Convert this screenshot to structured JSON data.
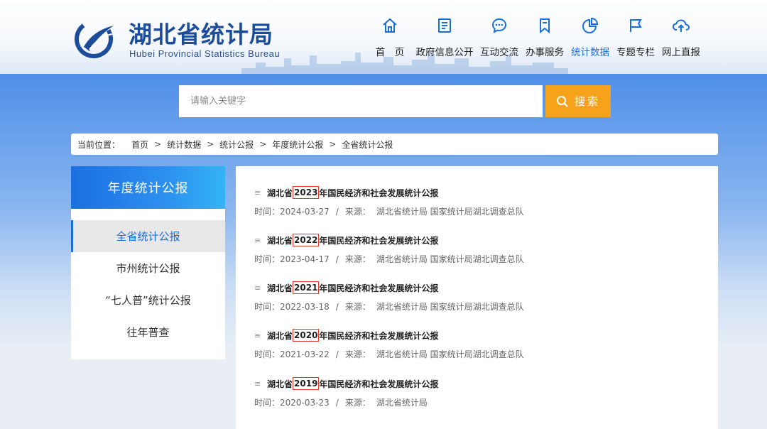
{
  "site": {
    "title": "湖北省统计局",
    "subtitle": "Hubei Provincial Statistics Bureau"
  },
  "nav": [
    {
      "label": "首　页",
      "icon": "home-icon"
    },
    {
      "label": "政府信息公开",
      "icon": "document-icon"
    },
    {
      "label": "互动交流",
      "icon": "chat-icon"
    },
    {
      "label": "办事服务",
      "icon": "bookmark-icon"
    },
    {
      "label": "统计数据",
      "icon": "pie-chart-icon",
      "active": true
    },
    {
      "label": "专题专栏",
      "icon": "flag-icon"
    },
    {
      "label": "网上直报",
      "icon": "cloud-upload-icon"
    }
  ],
  "search": {
    "placeholder": "请输入关键字",
    "button_label": "搜索"
  },
  "breadcrumb": {
    "prefix": "当前位置：",
    "items": [
      "首页",
      "统计数据",
      "统计公报",
      "年度统计公报",
      "全省统计公报"
    ]
  },
  "sidebar": {
    "title": "年度统计公报",
    "items": [
      {
        "label": "全省统计公报",
        "active": true
      },
      {
        "label": "市州统计公报"
      },
      {
        "label": "“七人普”统计公报"
      },
      {
        "label": "往年普查"
      }
    ]
  },
  "list": {
    "time_label": "时间：",
    "source_label": "来源：",
    "items": [
      {
        "prefix": "湖北省",
        "year": "2023",
        "suffix": "年国民经济和社会发展统计公报",
        "date": "2024-03-27",
        "source": "湖北省统计局 国家统计局湖北调查总队"
      },
      {
        "prefix": "湖北省",
        "year": "2022",
        "suffix": "年国民经济和社会发展统计公报",
        "date": "2023-04-17",
        "source": "湖北省统计局 国家统计局湖北调查总队"
      },
      {
        "prefix": "湖北省",
        "year": "2021",
        "suffix": "年国民经济和社会发展统计公报",
        "date": "2022-03-18",
        "source": "湖北省统计局 国家统计局湖北调查总队"
      },
      {
        "prefix": "湖北省",
        "year": "2020",
        "suffix": "年国民经济和社会发展统计公报",
        "date": "2021-03-22",
        "source": "湖北省统计局 国家统计局湖北调查总队"
      },
      {
        "prefix": "湖北省",
        "year": "2019",
        "suffix": "年国民经济和社会发展统计公报",
        "date": "2020-03-23",
        "source": "湖北省统计局"
      }
    ]
  },
  "colors": {
    "brand_blue": "#1d4d9a",
    "accent_blue": "#1a6ed8",
    "search_orange": "#f7a21b",
    "highlight_red": "#e23a2a"
  }
}
